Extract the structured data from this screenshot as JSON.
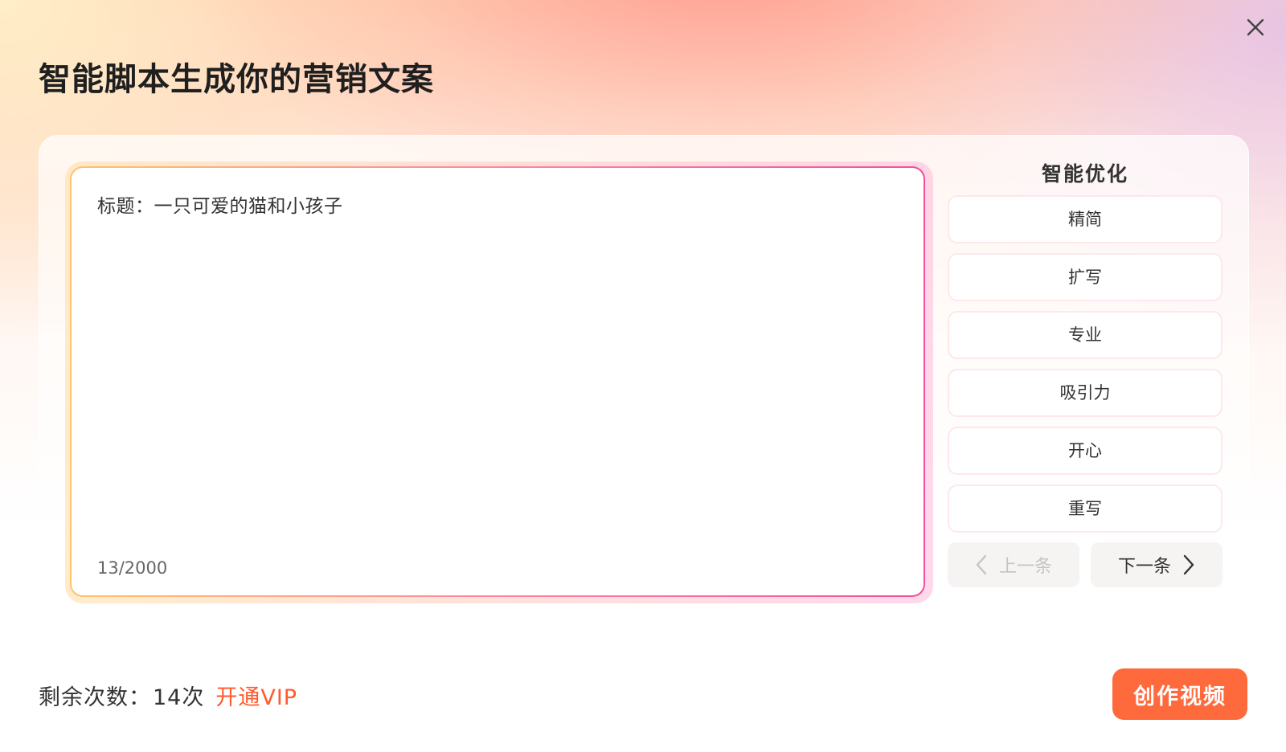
{
  "dialog": {
    "title": "智能脚本生成你的营销文案",
    "close_icon": "close-icon"
  },
  "editor": {
    "content": "标题：一只可爱的猫和小孩子",
    "char_count": "13/2000"
  },
  "optimize": {
    "title": "智能优化",
    "options": [
      "精简",
      "扩写",
      "专业",
      "吸引力",
      "开心",
      "重写"
    ],
    "prev_label": "上一条",
    "next_label": "下一条",
    "prev_disabled": true
  },
  "footer": {
    "remaining_label": "剩余次数：",
    "remaining_count": "14次",
    "vip_label": "开通VIP",
    "create_label": "创作视频"
  },
  "colors": {
    "accent": "#ff6a3d",
    "vip": "#ff5a2a"
  }
}
